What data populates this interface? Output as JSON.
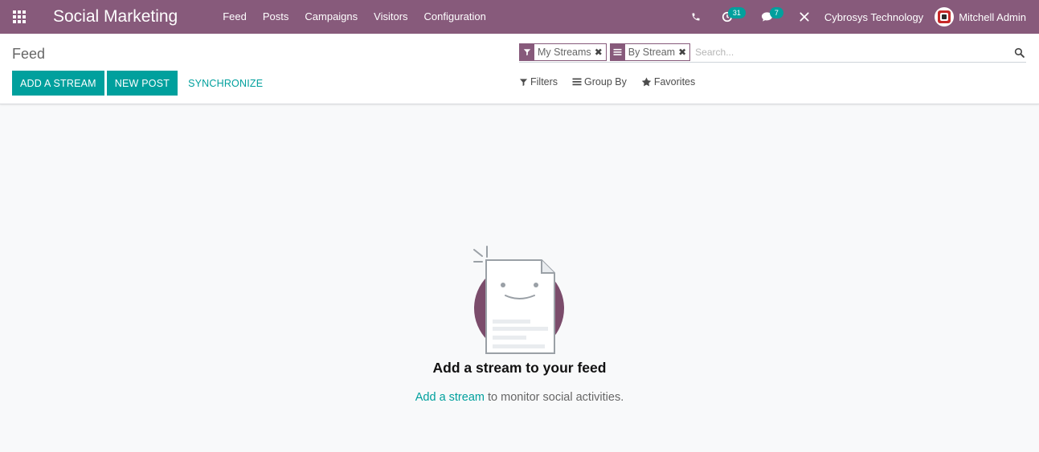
{
  "navbar": {
    "brand": "Social Marketing",
    "menu": [
      "Feed",
      "Posts",
      "Campaigns",
      "Visitors",
      "Configuration"
    ],
    "activity_count": "31",
    "messages_count": "7",
    "company": "Cybrosys Technology",
    "user": "Mitchell Admin"
  },
  "control": {
    "title": "Feed",
    "add_stream_label": "ADD A STREAM",
    "new_post_label": "NEW POST",
    "synchronize_label": "SYNCHRONIZE"
  },
  "search": {
    "facets": [
      {
        "label": "My Streams",
        "icon": "filter-icon"
      },
      {
        "label": "By Stream",
        "icon": "group-by-icon"
      }
    ],
    "placeholder": "Search..."
  },
  "filters": {
    "filters_label": "Filters",
    "group_by_label": "Group By",
    "favorites_label": "Favorites"
  },
  "empty_state": {
    "title": "Add a stream to your feed",
    "link_text": "Add a stream",
    "rest_text": " to monitor social activities."
  },
  "colors": {
    "brand": "#875a7b",
    "accent": "#00a09d"
  }
}
